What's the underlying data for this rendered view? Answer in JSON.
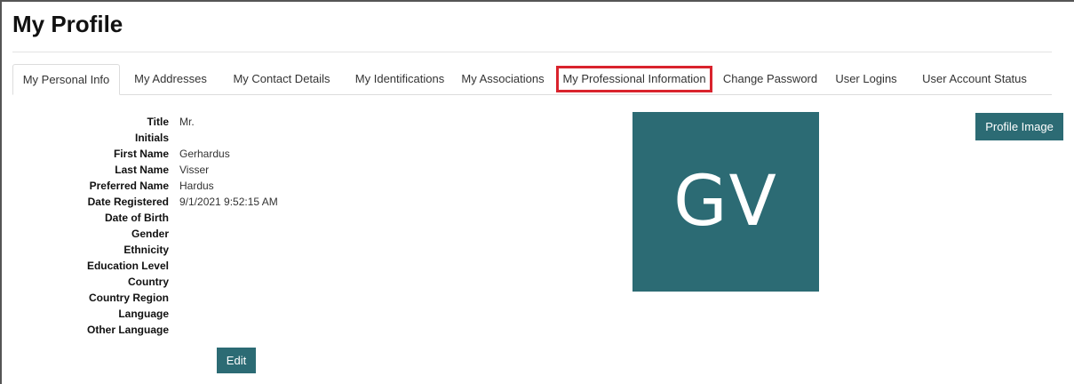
{
  "page": {
    "title": "My Profile"
  },
  "tabs": [
    {
      "label": "My Personal Info"
    },
    {
      "label": "My Addresses"
    },
    {
      "label": "My Contact Details"
    },
    {
      "label": "My Identifications"
    },
    {
      "label": "My Associations"
    },
    {
      "label": "My Professional Information"
    },
    {
      "label": "Change Password"
    },
    {
      "label": "User Logins"
    },
    {
      "label": "User Account Status"
    }
  ],
  "active_tab": "My Personal Info",
  "highlighted_tab": "My Professional Information",
  "fields": [
    {
      "label": "Title",
      "value": "Mr."
    },
    {
      "label": "Initials",
      "value": ""
    },
    {
      "label": "First Name",
      "value": "Gerhardus"
    },
    {
      "label": "Last Name",
      "value": "Visser"
    },
    {
      "label": "Preferred Name",
      "value": "Hardus"
    },
    {
      "label": "Date Registered",
      "value": "9/1/2021 9:52:15 AM"
    },
    {
      "label": "Date of Birth",
      "value": ""
    },
    {
      "label": "Gender",
      "value": ""
    },
    {
      "label": "Ethnicity",
      "value": ""
    },
    {
      "label": "Education Level",
      "value": ""
    },
    {
      "label": "Country",
      "value": ""
    },
    {
      "label": "Country Region",
      "value": ""
    },
    {
      "label": "Language",
      "value": ""
    },
    {
      "label": "Other Language",
      "value": ""
    }
  ],
  "avatar": {
    "initials": "GV",
    "color": "#2c6b74"
  },
  "buttons": {
    "edit": "Edit",
    "profile_image": "Profile Image"
  },
  "colors": {
    "accent": "#2c6b74",
    "highlight_border": "#d9232d"
  }
}
